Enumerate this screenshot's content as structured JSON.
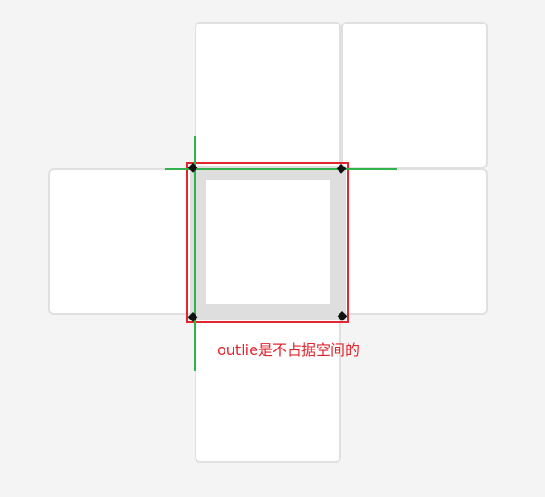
{
  "annotation": {
    "text": "outlie是不占据空间的",
    "color": "#e0262e"
  },
  "colors": {
    "background": "#f4f4f4",
    "tile_fill": "#ffffff",
    "tile_border": "#e0e0e0",
    "box_border": "#dedede",
    "outline": "#e0262e",
    "guide_lines": "#2fb34a",
    "handles": "#111111"
  },
  "handles": {
    "glyph": "◆",
    "icon": "resize-handle-icon"
  }
}
